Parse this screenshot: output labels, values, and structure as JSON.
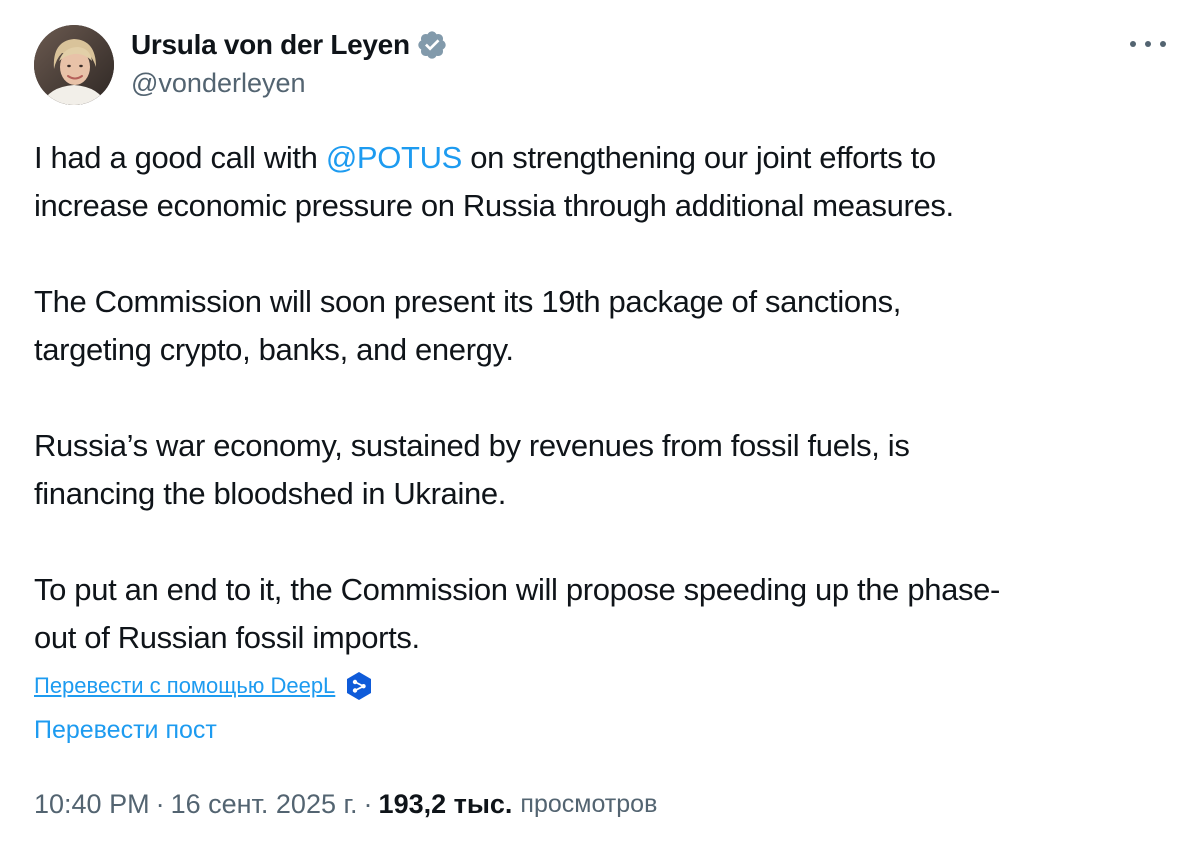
{
  "author": {
    "display_name": "Ursula von der Leyen",
    "handle": "@vonderleyen",
    "verified_color": "#829aab"
  },
  "tweet": {
    "paragraphs": [
      {
        "before": "I had a good call with ",
        "mention": "@POTUS",
        "after": " on strengthening our joint efforts to",
        "line2": "increase economic pressure on Russia through additional measures."
      },
      {
        "line1": "The Commission will soon present its 19th package of sanctions,",
        "line2": "targeting crypto, banks, and energy."
      },
      {
        "line1": "Russia’s war economy, sustained by revenues from fossil fuels, is",
        "line2": "financing the bloodshed in Ukraine."
      },
      {
        "line1": "To put an end to it, the Commission will propose speeding up the phase-",
        "line2": "out of Russian fossil imports."
      }
    ]
  },
  "translate": {
    "deepl_label": "Перевести с помощью DeepL",
    "post_label": "Перевести пост"
  },
  "meta": {
    "time": "10:40 PM",
    "separator": "·",
    "date": "16 сент. 2025 г.",
    "views_count": "193,2 тыс.",
    "views_label": "просмотров"
  },
  "colors": {
    "accent": "#1d9bf0",
    "text": "#0f1419",
    "secondary": "#536471",
    "deepl": "#0f5bd9"
  },
  "icons": {
    "verified": "verified-badge-icon",
    "deepl": "deepl-icon",
    "more": "more-options-icon"
  }
}
